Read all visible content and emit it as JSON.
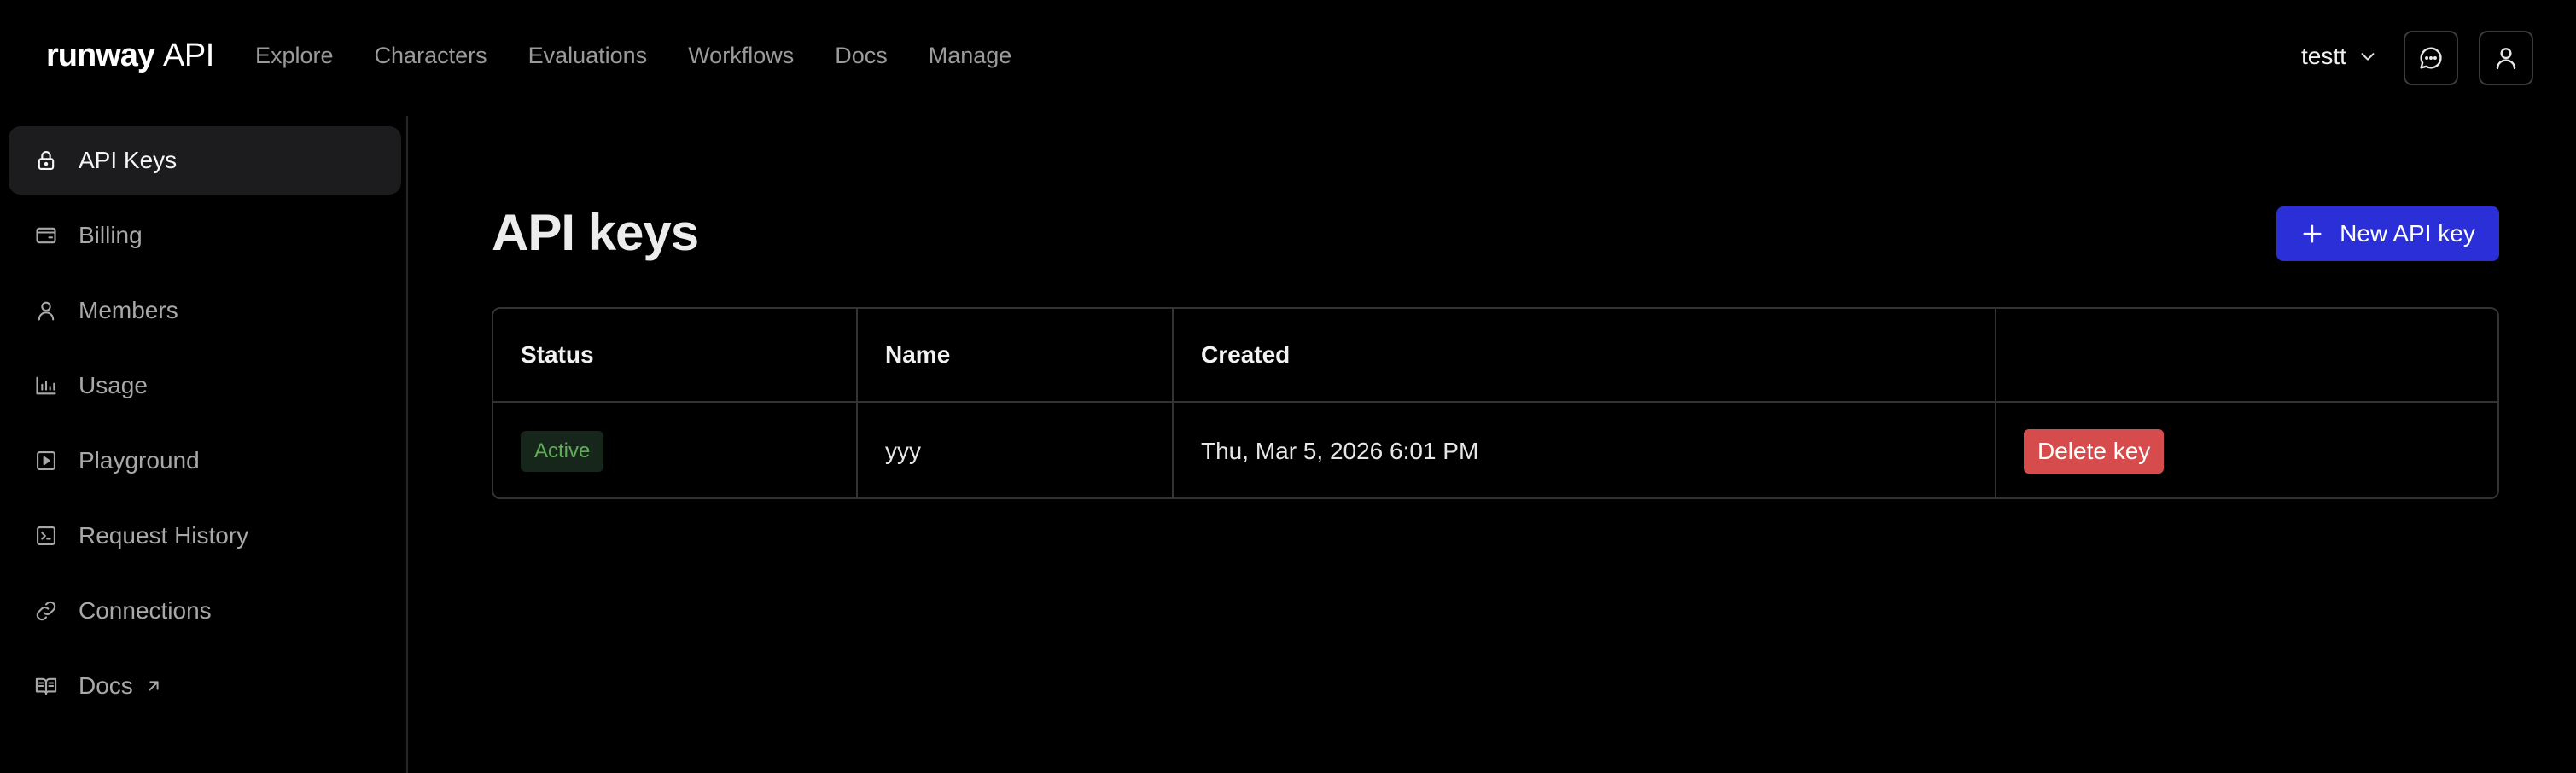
{
  "logo": {
    "word": "runway",
    "suffix": "API"
  },
  "topnav": [
    "Explore",
    "Characters",
    "Evaluations",
    "Workflows",
    "Docs",
    "Manage"
  ],
  "account": {
    "name": "testt"
  },
  "sidebar": {
    "items": [
      {
        "label": "API Keys",
        "icon": "lock-icon"
      },
      {
        "label": "Billing",
        "icon": "wallet-icon"
      },
      {
        "label": "Members",
        "icon": "person-icon"
      },
      {
        "label": "Usage",
        "icon": "bar-chart-icon"
      },
      {
        "label": "Playground",
        "icon": "play-square-icon"
      },
      {
        "label": "Request History",
        "icon": "terminal-icon"
      },
      {
        "label": "Connections",
        "icon": "link-icon"
      },
      {
        "label": "Docs",
        "icon": "book-icon"
      }
    ]
  },
  "main": {
    "title": "API keys",
    "new_key_label": "New API key",
    "table": {
      "headers": [
        "Status",
        "Name",
        "Created",
        ""
      ],
      "rows": [
        {
          "status": "Active",
          "name": "yyy",
          "created": "Thu, Mar 5, 2026 6:01 PM",
          "action": "Delete key"
        }
      ]
    }
  },
  "colors": {
    "background": "#000000",
    "accent": "#2b2fd8",
    "danger": "#d64c4c",
    "active_badge_text": "#5fae57",
    "sidebar_active_bg": "#1c1c1e"
  }
}
